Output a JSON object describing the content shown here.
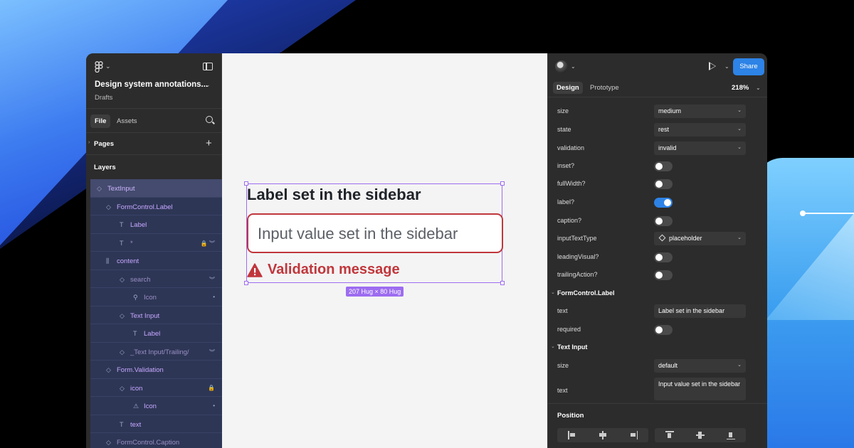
{
  "colors": {
    "accent": "#2d83e6",
    "selection": "#9d6cf0",
    "error": "#c0373c",
    "layer_bg": "#2e3656",
    "layer_text": "#c6a8ff"
  },
  "file": {
    "title": "Design system annotations...",
    "subtitle": "Drafts"
  },
  "left_tabs": {
    "file": "File",
    "assets": "Assets"
  },
  "pages_label": "Pages",
  "layers_label": "Layers",
  "layers": [
    {
      "icon": "component-instance-icon",
      "glyph": "◇",
      "label": "TextInput",
      "indent": 0,
      "style": "white",
      "selected": true,
      "right": ""
    },
    {
      "icon": "component-instance-icon",
      "glyph": "◇",
      "label": "FormControl.Label",
      "indent": 1,
      "style": "normal",
      "selected": false,
      "right": ""
    },
    {
      "icon": "text-layer-icon",
      "glyph": "T",
      "label": "Label",
      "indent": 2,
      "style": "normal",
      "selected": false,
      "right": ""
    },
    {
      "icon": "text-layer-icon",
      "glyph": "T",
      "label": "*",
      "indent": 2,
      "style": "dim",
      "selected": false,
      "right": "🔒 ︾"
    },
    {
      "icon": "auto-layout-icon",
      "glyph": "⫼",
      "label": "content",
      "indent": 1,
      "style": "normal",
      "selected": false,
      "right": ""
    },
    {
      "icon": "component-instance-icon",
      "glyph": "◇",
      "label": "search",
      "indent": 2,
      "style": "dim",
      "selected": false,
      "right": "︾"
    },
    {
      "icon": "search-layer-icon",
      "glyph": "⚲",
      "label": "Icon",
      "indent": 3,
      "style": "dim",
      "selected": false,
      "right": "•"
    },
    {
      "icon": "component-instance-icon",
      "glyph": "◇",
      "label": "Text Input",
      "indent": 2,
      "style": "normal",
      "selected": false,
      "right": ""
    },
    {
      "icon": "text-layer-icon",
      "glyph": "T",
      "label": "Label",
      "indent": 3,
      "style": "normal",
      "selected": false,
      "right": ""
    },
    {
      "icon": "component-instance-icon",
      "glyph": "◇",
      "label": "_Text Input/Trailing/",
      "indent": 2,
      "style": "dim",
      "selected": false,
      "right": "︾"
    },
    {
      "icon": "component-instance-icon",
      "glyph": "◇",
      "label": "Form.Validation",
      "indent": 1,
      "style": "normal",
      "selected": false,
      "right": ""
    },
    {
      "icon": "component-instance-icon",
      "glyph": "◇",
      "label": "icon",
      "indent": 2,
      "style": "normal",
      "selected": false,
      "right": "🔒"
    },
    {
      "icon": "alert-layer-icon",
      "glyph": "⚠",
      "label": "Icon",
      "indent": 3,
      "style": "normal",
      "selected": false,
      "right": "•"
    },
    {
      "icon": "text-layer-icon",
      "glyph": "T",
      "label": "text",
      "indent": 2,
      "style": "normal",
      "selected": false,
      "right": ""
    },
    {
      "icon": "component-instance-icon",
      "glyph": "◇",
      "label": "FormControl.Caption",
      "indent": 1,
      "style": "dim",
      "selected": false,
      "right": ""
    }
  ],
  "canvas": {
    "label_text": "Label set in the sidebar",
    "input_value": "Input value set in the sidebar",
    "validation_message": "Validation message",
    "size_badge": "207 Hug × 80 Hug"
  },
  "right_header": {
    "share": "Share",
    "design_tab": "Design",
    "prototype_tab": "Prototype",
    "zoom": "218%"
  },
  "props": {
    "size_label": "size",
    "size_value": "medium",
    "state_label": "state",
    "state_value": "rest",
    "validation_label": "validation",
    "validation_value": "invalid",
    "inset_label": "inset?",
    "inset_on": false,
    "fullwidth_label": "fullWidth?",
    "fullwidth_on": false,
    "label_label": "label?",
    "label_on": true,
    "caption_label": "caption?",
    "caption_on": false,
    "inputtexttype_label": "inputTextType",
    "inputtexttype_value": "placeholder",
    "leadingvisual_label": "leadingVisual?",
    "leadingvisual_on": false,
    "trailingaction_label": "trailingAction?",
    "trailingaction_on": false,
    "section_formcontrol": "FormControl.Label",
    "fc_text_label": "text",
    "fc_text_value": "Label set in the sidebar",
    "fc_required_label": "required",
    "fc_required_on": false,
    "section_textinput": "Text Input",
    "ti_size_label": "size",
    "ti_size_value": "default",
    "ti_text_label": "text",
    "ti_text_value": "Input value set in the sidebar"
  },
  "position_label": "Position"
}
